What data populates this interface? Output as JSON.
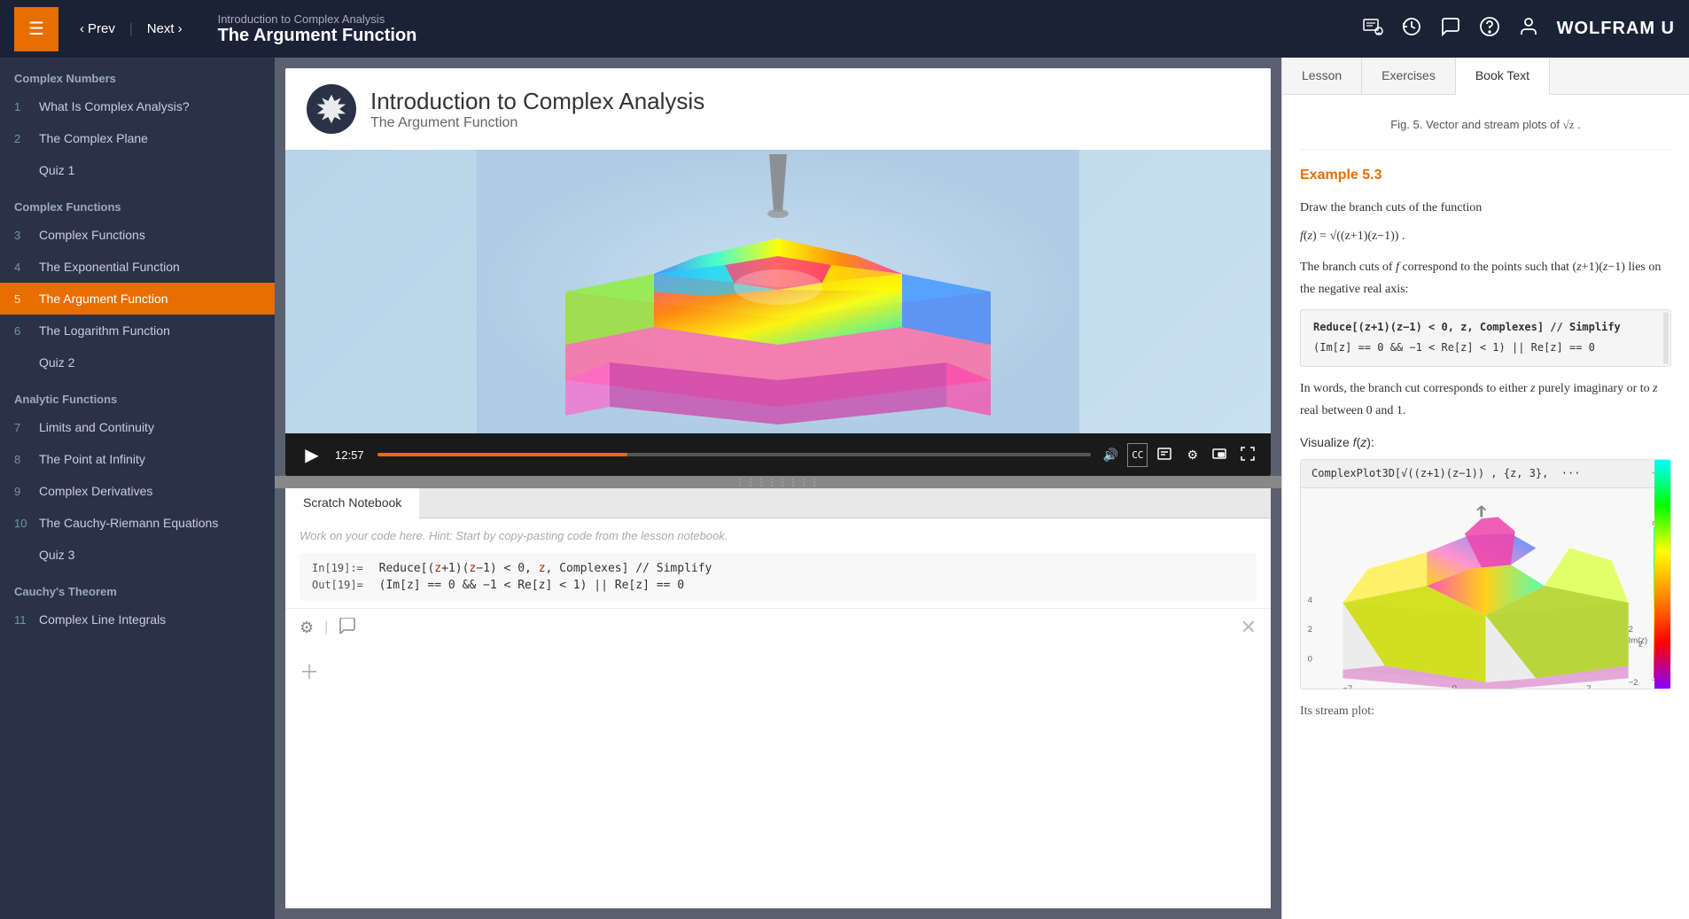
{
  "nav": {
    "prev_label": "Prev",
    "next_label": "Next",
    "course_title": "Introduction to Complex Analysis",
    "lesson_title": "The Argument Function",
    "icons": {
      "menu": "☰",
      "prev_arrow": "‹",
      "next_arrow": "›",
      "certificate": "📋",
      "history": "🕐",
      "chat": "💬",
      "help": "?",
      "user": "👤"
    },
    "wolfram_u": "WOLFRAM U"
  },
  "sidebar": {
    "sections": [
      {
        "title": "Complex Numbers",
        "items": [
          {
            "num": "1",
            "label": "What Is Complex Analysis?",
            "active": false
          },
          {
            "num": "2",
            "label": "The Complex Plane",
            "active": false
          }
        ],
        "quiz": "Quiz 1"
      },
      {
        "title": "Complex Functions",
        "items": [
          {
            "num": "3",
            "label": "Complex Functions",
            "active": false
          },
          {
            "num": "4",
            "label": "The Exponential Function",
            "active": false
          },
          {
            "num": "5",
            "label": "The Argument Function",
            "active": true
          },
          {
            "num": "6",
            "label": "The Logarithm Function",
            "active": false
          }
        ],
        "quiz": "Quiz 2"
      },
      {
        "title": "Analytic Functions",
        "items": [
          {
            "num": "7",
            "label": "Limits and Continuity",
            "active": false
          },
          {
            "num": "8",
            "label": "The Point at Infinity",
            "active": false
          },
          {
            "num": "9",
            "label": "Complex Derivatives",
            "active": false
          },
          {
            "num": "10",
            "label": "The Cauchy-Riemann Equations",
            "active": false
          }
        ],
        "quiz": "Quiz 3"
      },
      {
        "title": "Cauchy's Theorem",
        "items": [
          {
            "num": "11",
            "label": "Complex Line Integrals",
            "active": false
          }
        ]
      }
    ]
  },
  "video": {
    "course_name": "Introduction to Complex Analysis",
    "lesson_name": "The Argument Function",
    "time_display": "12:57",
    "controls": {
      "play": "▶",
      "volume": "🔊",
      "captions": "CC",
      "notebook": "📓",
      "settings": "⚙",
      "pip": "⧉",
      "fullscreen": "⛶"
    }
  },
  "notebook": {
    "tab_label": "Scratch Notebook",
    "hint": "Work on your code here. Hint: Start by copy-pasting code from the lesson notebook.",
    "cells": [
      {
        "in_label": "In[19]:=",
        "in_code": "Reduce[(z+1)(z-1) < 0, z, Complexes] // Simplify",
        "out_label": "Out[19]=",
        "out_code": "(Im[z] == 0 && -1 < Re[z] < 1) || Re[z] == 0"
      }
    ]
  },
  "right_panel": {
    "tabs": [
      "Lesson",
      "Exercises",
      "Book Text"
    ],
    "active_tab": "Book Text",
    "content": {
      "fig_caption": "Fig. 5. Vector and stream plots of √z .",
      "example_number": "Example 5.3",
      "text1": "Draw the branch cuts of the function",
      "formula1": "f(z) = √((z+1)(z−1)) .",
      "text2": "The branch cuts of f correspond to the points such that (z+1)(z−1) lies on the negative real axis:",
      "code1_line1": "Reduce[(z+1)(z−1) < 0, z, Complexes] // Simplify",
      "code1_line2": "(Im[z] == 0 && −1 < Re[z] < 1) || Re[z] == 0",
      "text3": "In words, the branch cut corresponds to either z purely imaginary or to z real between 0 and 1.",
      "viz_label": "Visualize f(z):",
      "viz_code": "ComplexPlot3D[√((z+1)(z−1)) , {z, 3},  ···"
    }
  }
}
